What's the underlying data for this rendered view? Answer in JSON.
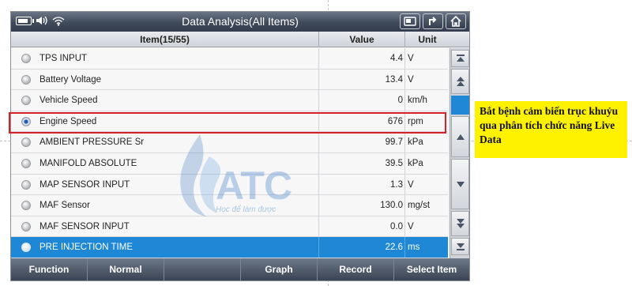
{
  "window": {
    "title": "Data Analysis(All Items)"
  },
  "table": {
    "columns": {
      "item": "Item(15/55)",
      "value": "Value",
      "unit": "Unit"
    },
    "rows": [
      {
        "name": "TPS INPUT",
        "value": "4.4",
        "unit": "V"
      },
      {
        "name": "Battery Voltage",
        "value": "13.4",
        "unit": "V"
      },
      {
        "name": "Vehicle Speed",
        "value": "0",
        "unit": "km/h"
      },
      {
        "name": "Engine Speed",
        "value": "676",
        "unit": "rpm"
      },
      {
        "name": "AMBIENT PRESSURE Sr",
        "value": "99.7",
        "unit": "kPa"
      },
      {
        "name": "MANIFOLD ABSOLUTE",
        "value": "39.5",
        "unit": "kPa"
      },
      {
        "name": "MAP SENSOR INPUT",
        "value": "1.3",
        "unit": "V"
      },
      {
        "name": "MAF Sensor",
        "value": "130.0",
        "unit": "mg/st"
      },
      {
        "name": "MAF SENSOR INPUT",
        "value": "0.0",
        "unit": "V"
      },
      {
        "name": "PRE INJECTION TIME",
        "value": "22.6",
        "unit": "ms"
      }
    ]
  },
  "footer": {
    "buttons": [
      "Function",
      "Normal",
      "",
      "Graph",
      "Record",
      "Select Item"
    ]
  },
  "watermark": {
    "logo": "ATC",
    "tagline": "Học để làm được"
  },
  "annotation": {
    "text": "Bắt bệnh cảm biến trục khuỷu qua phân tích chức năng Live Data",
    "color": "#fff200"
  },
  "colors": {
    "selected_row": "#1e87d6",
    "highlight_border": "#d61f26"
  }
}
